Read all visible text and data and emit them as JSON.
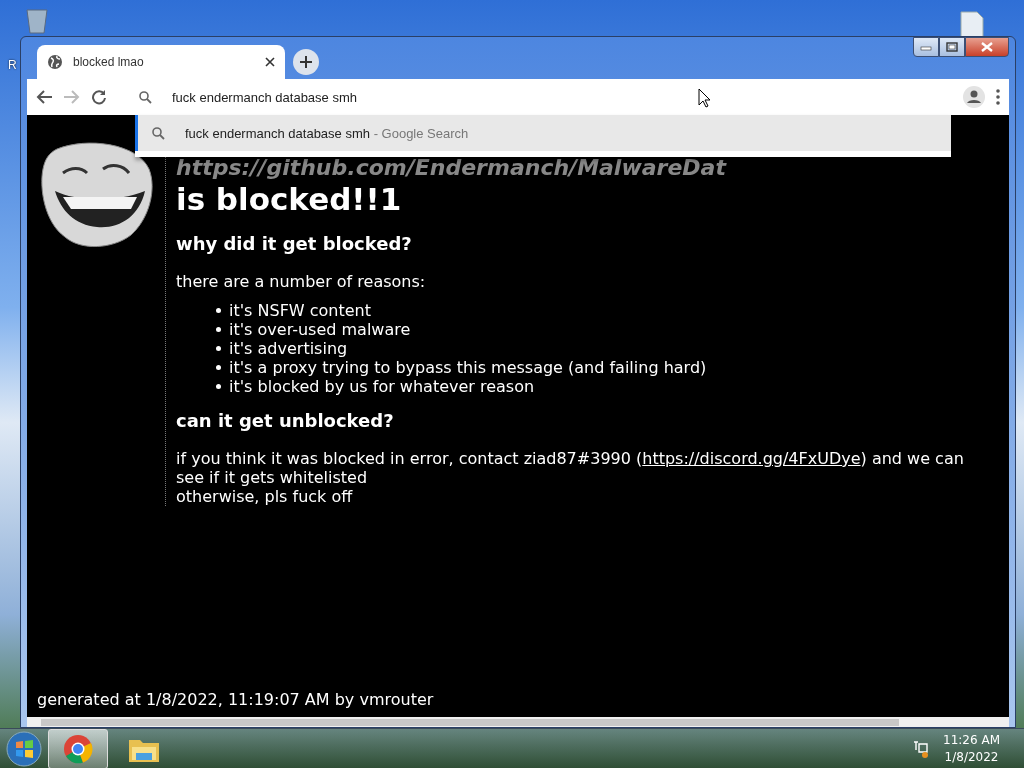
{
  "desktop": {
    "icon_label": "R"
  },
  "tabs": [
    {
      "title": "blocked lmao",
      "selected": true
    }
  ],
  "omnibox": {
    "value": "fuck endermanch database smh"
  },
  "suggestions": [
    {
      "query": "fuck endermanch database smh",
      "source": "- Google Search",
      "selected": true
    }
  ],
  "page": {
    "url_heading": "https://github.com/Endermanch/MalwareDat",
    "title": "is blocked!!1",
    "sections": [
      {
        "heading": "why did it get blocked?",
        "intro": "there are a number of reasons:",
        "items": [
          "it's NSFW content",
          "it's over-used malware",
          "it's advertising",
          "it's a proxy trying to bypass this message (and failing hard)",
          "it's blocked by us for whatever reason"
        ]
      },
      {
        "heading": "can it get unblocked?",
        "before": "if you think it was blocked in error, contact ziad87#3990 (",
        "link": "https://discord.gg/4FxUDye",
        "after": ") and we can see if it gets whitelisted",
        "last": "otherwise, pls fuck off"
      }
    ],
    "footer": "generated at 1/8/2022, 11:19:07 AM by vmrouter"
  },
  "taskbar": {
    "apps": [
      {
        "kind": "chrome",
        "selected": true
      },
      {
        "kind": "explorer",
        "selected": false
      }
    ],
    "clock": {
      "time": "11:26 AM",
      "date": "1/8/2022"
    }
  }
}
